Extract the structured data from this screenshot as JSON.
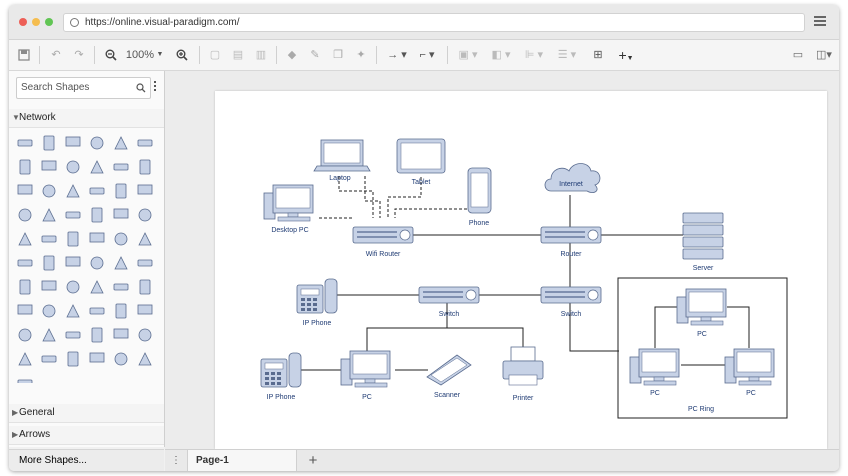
{
  "browser": {
    "url": "https://online.visual-paradigm.com/",
    "traffic_lights": {
      "close": "#ed5f57",
      "minimize": "#f5bd4f",
      "maximize": "#61c554"
    }
  },
  "toolbar": {
    "zoom_level": "100%"
  },
  "sidebar": {
    "search_placeholder": "Search Shapes",
    "sections": [
      {
        "label": "Network",
        "expanded": true
      },
      {
        "label": "General",
        "expanded": false
      },
      {
        "label": "Arrows",
        "expanded": false
      }
    ],
    "more_shapes_label": "More Shapes..."
  },
  "pages": {
    "tabs": [
      {
        "label": "Page-1"
      }
    ]
  },
  "diagram": {
    "nodes": {
      "laptop": "Laptop",
      "tablet": "Tablet",
      "phone": "Phone",
      "desktop_pc": "Desktop PC",
      "wifi_router": "Wifi Router",
      "internet": "Internet",
      "router": "Router",
      "server": "Server",
      "ip_phone_1": "IP Phone",
      "switch_1": "Switch",
      "switch_2": "Switch",
      "ip_phone_2": "IP Phone",
      "pc_1": "PC",
      "scanner": "Scanner",
      "printer": "Printer",
      "ring_pc_top": "PC",
      "ring_pc_left": "PC",
      "ring_pc_right": "PC",
      "pc_ring": "PC Ring"
    }
  },
  "colors": {
    "device_fill": "#c7d2e6",
    "device_stroke": "#5a6c8f",
    "label": "#1f3b73"
  }
}
